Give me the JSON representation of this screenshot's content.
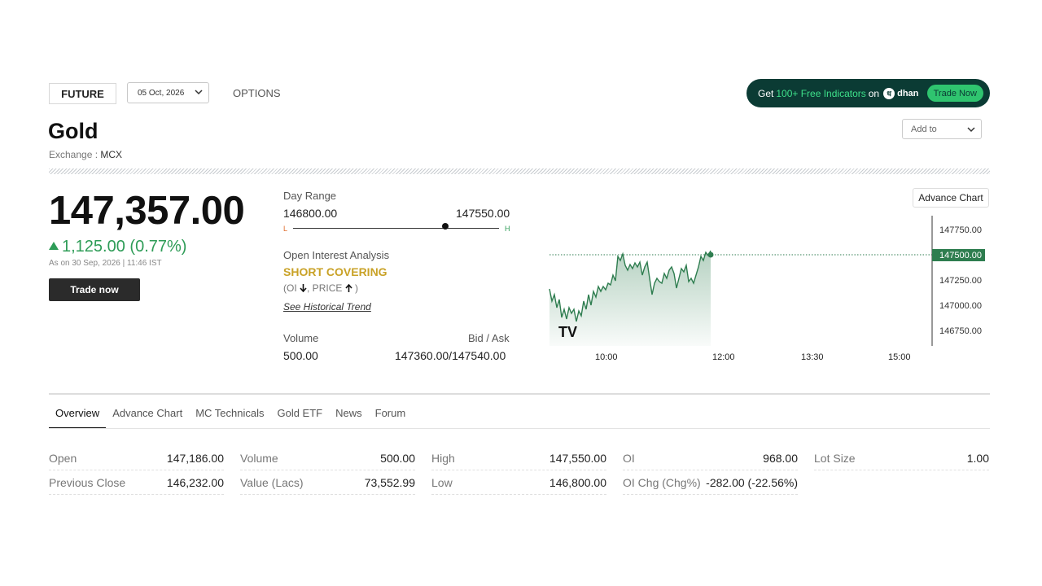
{
  "top": {
    "future_tab": "FUTURE",
    "expiry_date": "05 Oct, 2026",
    "options_tab": "OPTIONS"
  },
  "promo": {
    "prefix": "Get",
    "highlight": "100+ Free Indicators",
    "on": "on",
    "brand": "dhan",
    "cta": "Trade Now"
  },
  "add_to": "Add to",
  "instrument": {
    "name": "Gold",
    "exchange_label": "Exchange :",
    "exchange": "MCX"
  },
  "quote": {
    "price": "147,357.00",
    "change": "1,125.00 (0.77%)",
    "as_of": "As on 30 Sep, 2026 | 11:46 IST",
    "trade_button": "Trade now"
  },
  "day_range": {
    "label": "Day Range",
    "low": "146800.00",
    "high": "147550.00",
    "low_marker": "L",
    "high_marker": "H",
    "position_fraction": 0.73
  },
  "oi_analysis": {
    "label": "Open Interest Analysis",
    "signal": "SHORT COVERING",
    "note_oi": "(OI",
    "note_price": ", PRICE",
    "note_close": ")",
    "link": "See Historical Trend"
  },
  "volume_block": {
    "volume_label": "Volume",
    "volume_value": "500.00",
    "bidask_label": "Bid / Ask",
    "bidask_value": "147360.00/147540.00"
  },
  "chart": {
    "advance_chart_button": "Advance Chart",
    "y_ticks": [
      "147750.00",
      "147500.00",
      "147250.00",
      "147000.00",
      "146750.00"
    ],
    "current_label": "147500.00",
    "x_ticks": [
      "10:00",
      "12:00",
      "13:30",
      "15:00"
    ],
    "logo": "TV",
    "accent": "#2e7d4f"
  },
  "tabs": [
    "Overview",
    "Advance Chart",
    "MC Technicals",
    "Gold ETF",
    "News",
    "Forum"
  ],
  "stats": [
    [
      {
        "k": "Open",
        "v": "147,186.00"
      },
      {
        "k": "Previous Close",
        "v": "146,232.00"
      }
    ],
    [
      {
        "k": "Volume",
        "v": "500.00"
      },
      {
        "k": "Value (Lacs)",
        "v": "73,552.99"
      }
    ],
    [
      {
        "k": "High",
        "v": "147,550.00"
      },
      {
        "k": "Low",
        "v": "146,800.00"
      }
    ],
    [
      {
        "k": "OI",
        "v": "968.00"
      },
      {
        "k": "OI Chg (Chg%)",
        "v": "-282.00 (-22.56%)"
      }
    ],
    [
      {
        "k": "Lot Size",
        "v": "1.00"
      }
    ]
  ]
}
